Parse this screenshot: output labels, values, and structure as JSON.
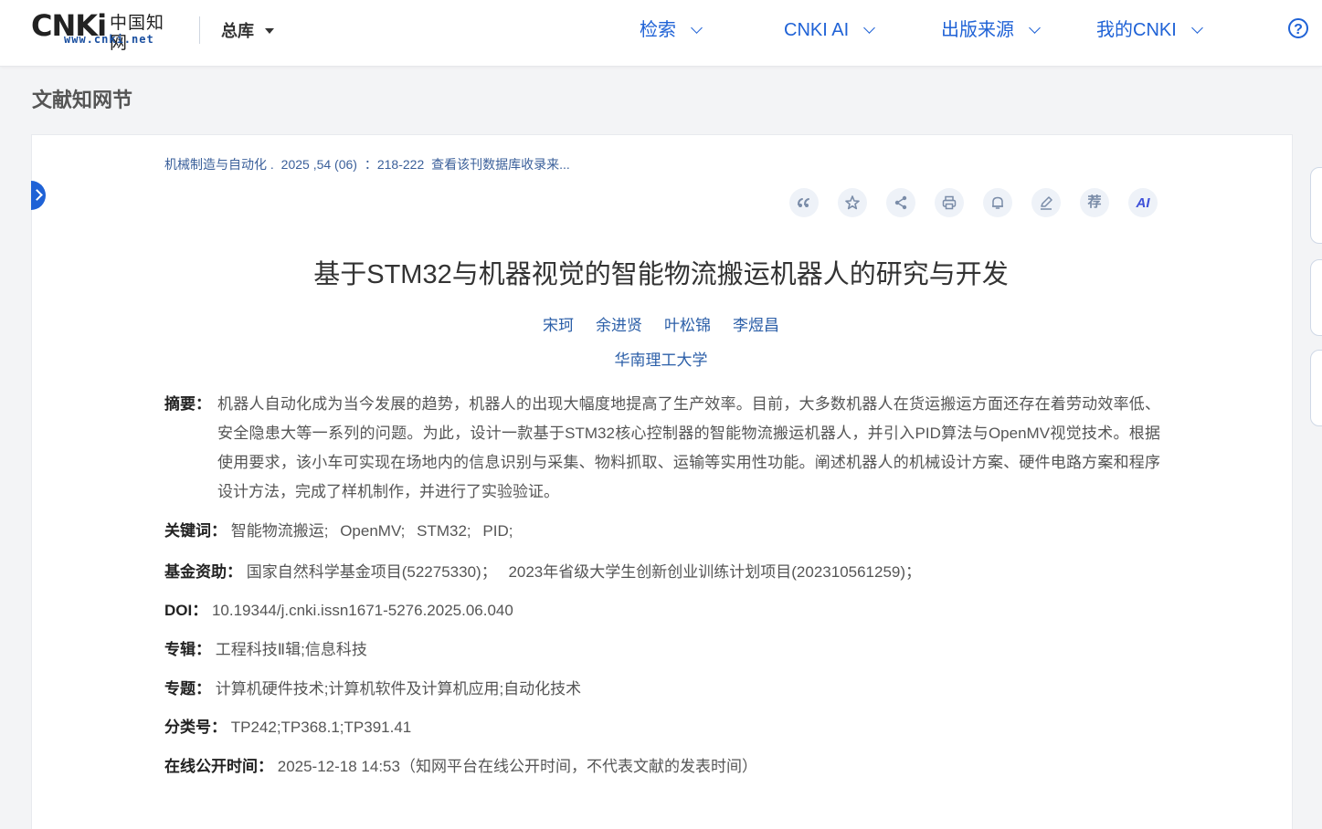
{
  "header": {
    "logo_main": "CNKi",
    "logo_cn": "中国知网",
    "logo_url": "www.cnki.net",
    "db_select": "总库",
    "nav": [
      "检索",
      "CNKI AI",
      "出版来源",
      "我的CNKI"
    ],
    "help": "?"
  },
  "page_title": "文献知网节",
  "article": {
    "source": "机械制造与自动化 .",
    "year_vol_issue": "2025 ,54 (06)",
    "pages": "：218-222",
    "db_link": "查看该刊数据库收录来...",
    "toolbar": [
      "quote",
      "favorite",
      "share",
      "print",
      "alert",
      "note",
      "recommend",
      "ai"
    ],
    "recommend_label": "荐",
    "ai_label": "AI",
    "title": "基于STM32与机器视觉的智能物流搬运机器人的研究与开发",
    "authors": [
      "宋珂",
      "余进贤",
      "叶松锦",
      "李煜昌"
    ],
    "organization": "华南理工大学",
    "abstract_label": "摘要：",
    "abstract": "机器人自动化成为当今发展的趋势，机器人的出现大幅度地提高了生产效率。目前，大多数机器人在货运搬运方面还存在着劳动效率低、安全隐患大等一系列的问题。为此，设计一款基于STM32核心控制器的智能物流搬运机器人，并引入PID算法与OpenMV视觉技术。根据使用要求，该小车可实现在场地内的信息识别与采集、物料抓取、运输等实用性功能。阐述机器人的机械设计方案、硬件电路方案和程序设计方法，完成了样机制作，并进行了实验验证。",
    "keywords_label": "关键词：",
    "keywords": [
      "智能物流搬运;",
      "OpenMV;",
      "STM32;",
      "PID;"
    ],
    "fund_label": "基金资助：",
    "funds": [
      "国家自然科学基金项目(52275330)；",
      "2023年省级大学生创新创业训练计划项目(202310561259)；"
    ],
    "doi_label": "DOI：",
    "doi": "10.19344/j.cnki.issn1671-5276.2025.06.040",
    "series_label": "专辑：",
    "series": "工程科技Ⅱ辑;信息科技",
    "subject_label": "专题：",
    "subject": "计算机硬件技术;计算机软件及计算机应用;自动化技术",
    "class_label": "分类号：",
    "class_no": "TP242;TP368.1;TP391.41",
    "online_label": "在线公开时间：",
    "online_time": "2025-12-18 14:53（知网平台在线公开时间，不代表文献的发表时间）"
  },
  "colors": {
    "accent": "#1f62d6",
    "link": "#2c5fa8",
    "icon_bg": "#eef2f8"
  }
}
